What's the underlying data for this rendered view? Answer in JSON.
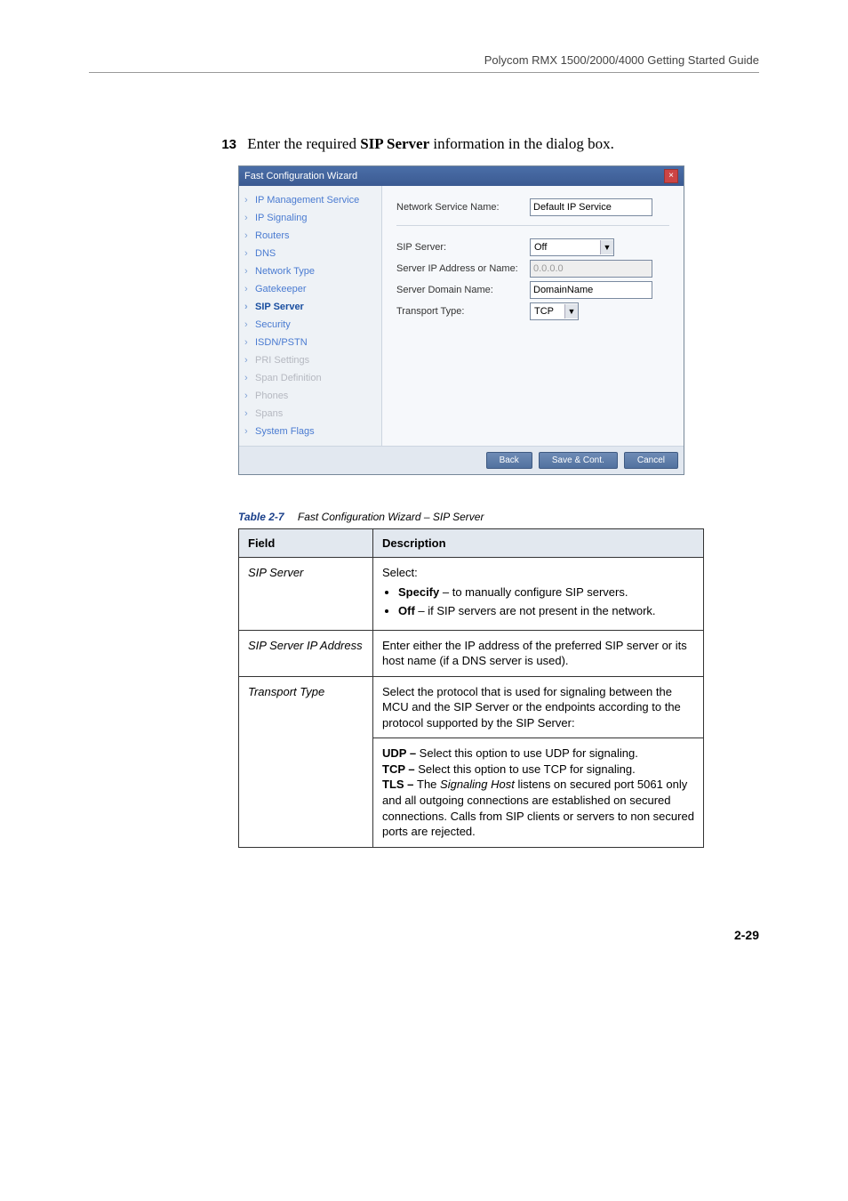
{
  "header": {
    "guide_title": "Polycom RMX 1500/2000/4000 Getting Started Guide"
  },
  "step": {
    "number": "13",
    "text_prefix": "Enter the required ",
    "text_bold": "SIP Server",
    "text_suffix": " information in the dialog box."
  },
  "wizard": {
    "title": "Fast Configuration Wizard",
    "close_glyph": "×",
    "nav": [
      {
        "label": "IP Management Service",
        "state": "normal"
      },
      {
        "label": "IP Signaling",
        "state": "normal"
      },
      {
        "label": "Routers",
        "state": "normal"
      },
      {
        "label": "DNS",
        "state": "normal"
      },
      {
        "label": "Network Type",
        "state": "normal"
      },
      {
        "label": "Gatekeeper",
        "state": "normal"
      },
      {
        "label": "SIP Server",
        "state": "current"
      },
      {
        "label": "Security",
        "state": "normal"
      },
      {
        "label": "ISDN/PSTN",
        "state": "normal"
      },
      {
        "label": "PRI Settings",
        "state": "disabled"
      },
      {
        "label": "Span Definition",
        "state": "disabled"
      },
      {
        "label": "Phones",
        "state": "disabled"
      },
      {
        "label": "Spans",
        "state": "disabled"
      },
      {
        "label": "System Flags",
        "state": "normal"
      }
    ],
    "form": {
      "network_service_label": "Network Service Name:",
      "network_service_value": "Default IP Service",
      "sip_server_label": "SIP Server:",
      "sip_server_value": "Off",
      "server_ip_label": "Server IP Address or Name:",
      "server_ip_value": "0.0.0.0",
      "server_domain_label": "Server Domain Name:",
      "server_domain_value": "DomainName",
      "transport_type_label": "Transport Type:",
      "transport_type_value": "TCP"
    },
    "buttons": {
      "back": "Back",
      "save": "Save & Cont.",
      "cancel": "Cancel"
    }
  },
  "table_caption": {
    "label": "Table 2-7",
    "text": "Fast Configuration Wizard – SIP Server"
  },
  "table": {
    "header_field": "Field",
    "header_desc": "Description",
    "rows": {
      "sip_server": {
        "field": "SIP Server",
        "desc_intro": "Select:",
        "opt1_bold": "Specify",
        "opt1_rest": " – to manually configure SIP servers.",
        "opt2_bold": "Off",
        "opt2_rest": " – if SIP servers are not present in the network."
      },
      "sip_ip": {
        "field": "SIP Server IP Address",
        "desc": "Enter either the IP address of the preferred SIP server or its host name (if a DNS server is used)."
      },
      "transport": {
        "field": "Transport Type",
        "desc": "Select the protocol that is used for signaling between the MCU and the SIP Server or the endpoints according to the protocol supported by the SIP Server:"
      },
      "transport2": {
        "udp_bold": "UDP – ",
        "udp_rest": "Select this option to use UDP for signaling.",
        "tcp_bold": "TCP – ",
        "tcp_rest": "Select this option to use TCP for signaling.",
        "tls_bold": "TLS – ",
        "tls_mid": "The ",
        "tls_italic": "Signaling Host",
        "tls_rest": " listens on secured port 5061 only and all outgoing connections are established on secured connections. Calls from SIP clients or servers to non secured ports are rejected."
      }
    }
  },
  "page_number": "2-29"
}
